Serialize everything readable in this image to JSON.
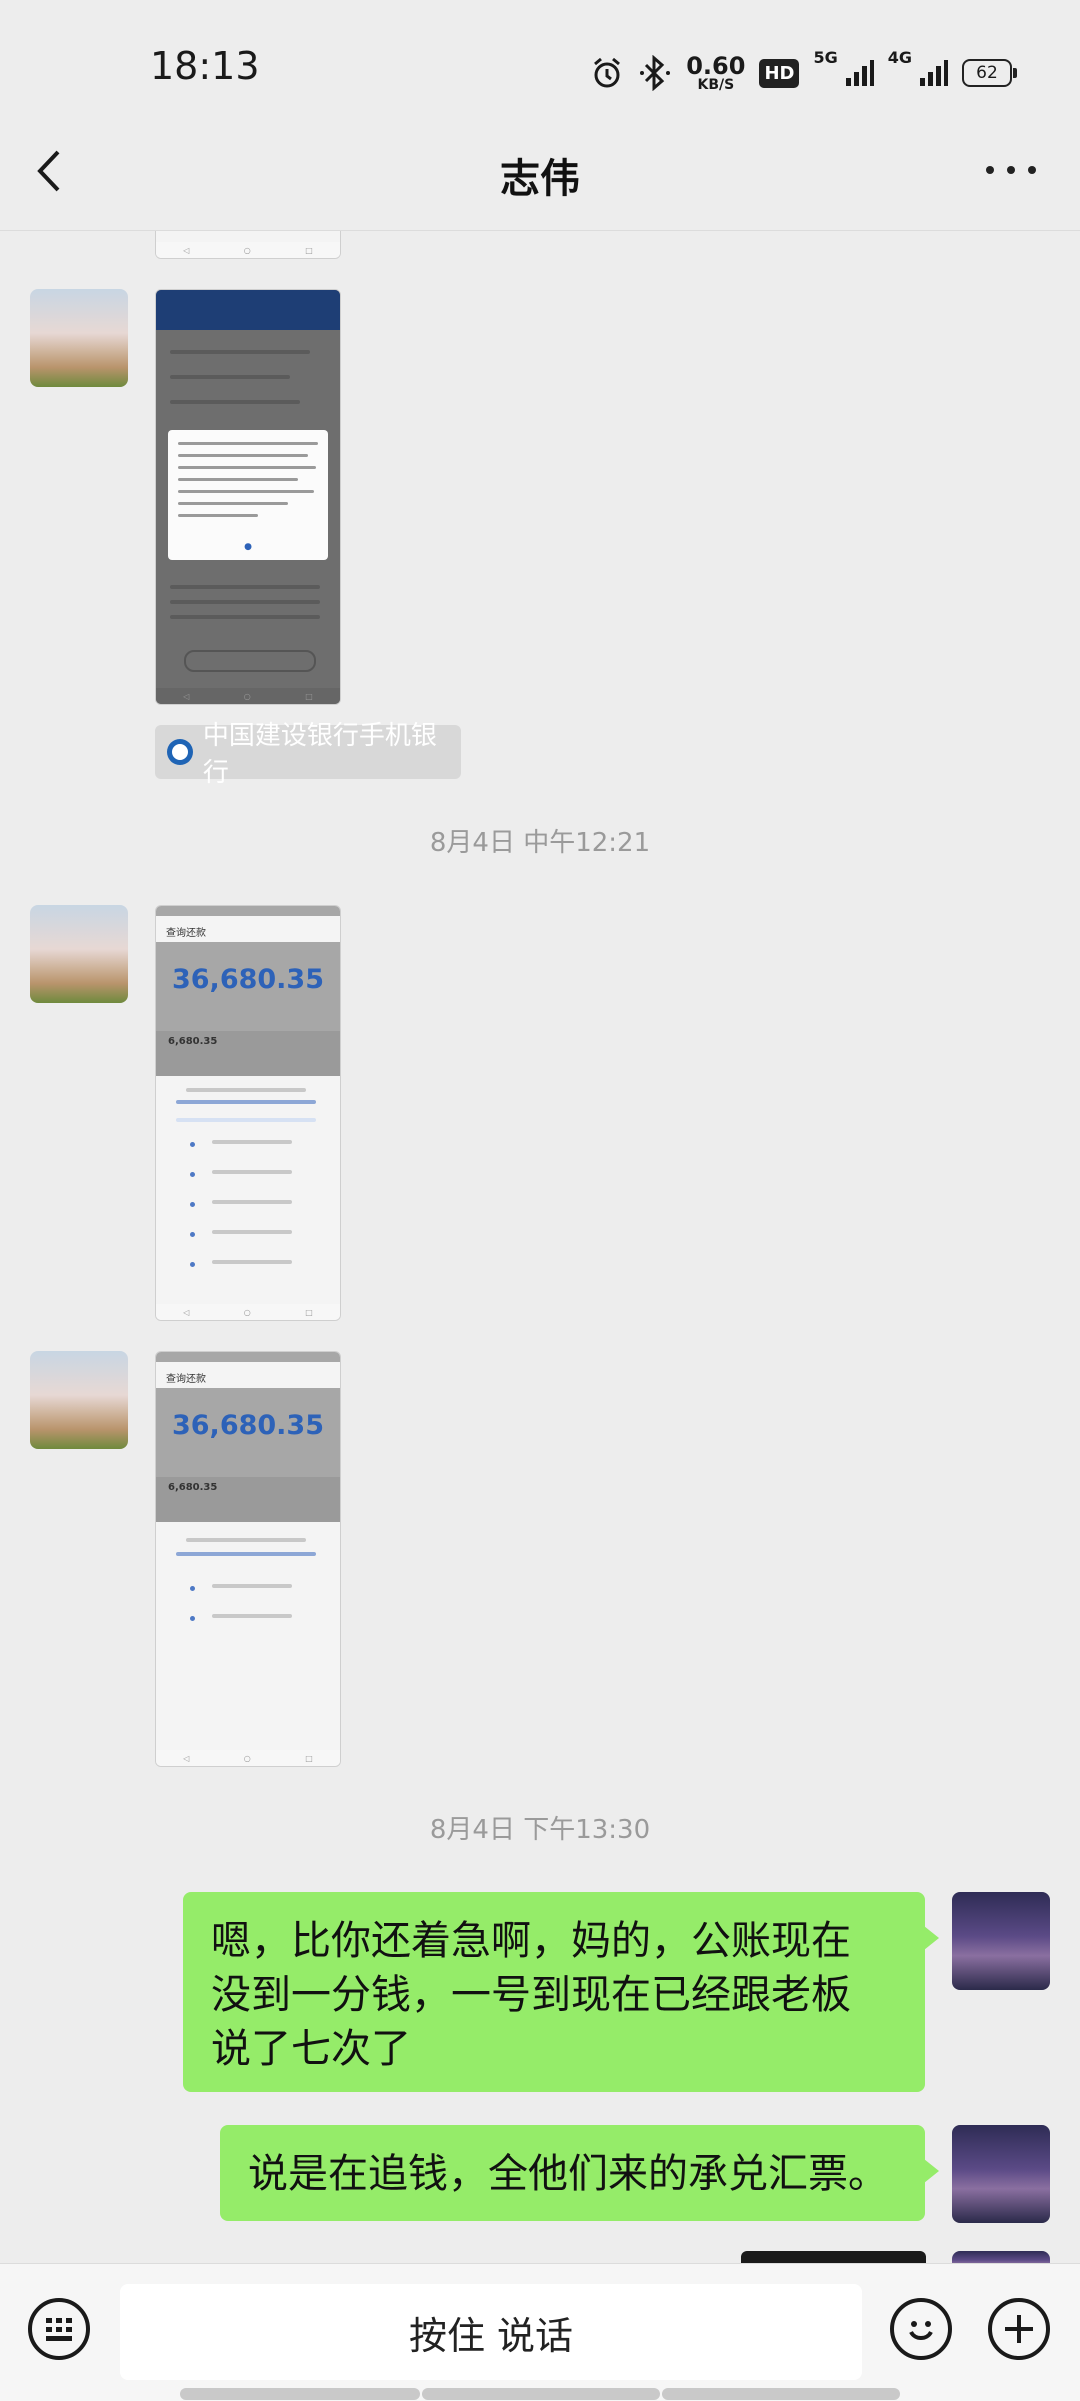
{
  "status_bar": {
    "time": "18:13",
    "net_speed_value": "0.60",
    "net_speed_unit": "KB/S",
    "hd_badge": "HD",
    "net1": "5G",
    "net2": "4G",
    "battery": "62",
    "icons": [
      "alarm-icon",
      "bluetooth-icon",
      "signal-icon",
      "signal-icon",
      "battery-icon"
    ]
  },
  "nav": {
    "title": "志伟",
    "back_icon": "chevron-left-icon",
    "more_icon": "more-dots-icon"
  },
  "chat": {
    "ccb_card_label": "中国建设银行手机银行",
    "timestamp_1": "8月4日 中午12:21",
    "timestamp_2": "8月4日 下午13:30",
    "screenshot_1": {
      "title": "查询还款",
      "amount": "36,680.35",
      "sub_amount": "6,680.35"
    },
    "screenshot_2": {
      "title": "查询还款",
      "amount": "36,680.35",
      "sub_amount": "6,680.35"
    },
    "messages": [
      {
        "from": "me",
        "lines": [
          "嗯，比你还着急啊，妈的，公账现在",
          "没到一分钱，一号到现在已经跟老板",
          "说了七次了"
        ]
      },
      {
        "from": "me",
        "lines": [
          "说是在追钱，全他们来的承兑汇票。"
        ]
      }
    ]
  },
  "input_bar": {
    "voice_label": "按住 说话",
    "left_icon": "keyboard-icon",
    "emoji_icon": "emoji-icon",
    "plus_icon": "plus-icon"
  }
}
